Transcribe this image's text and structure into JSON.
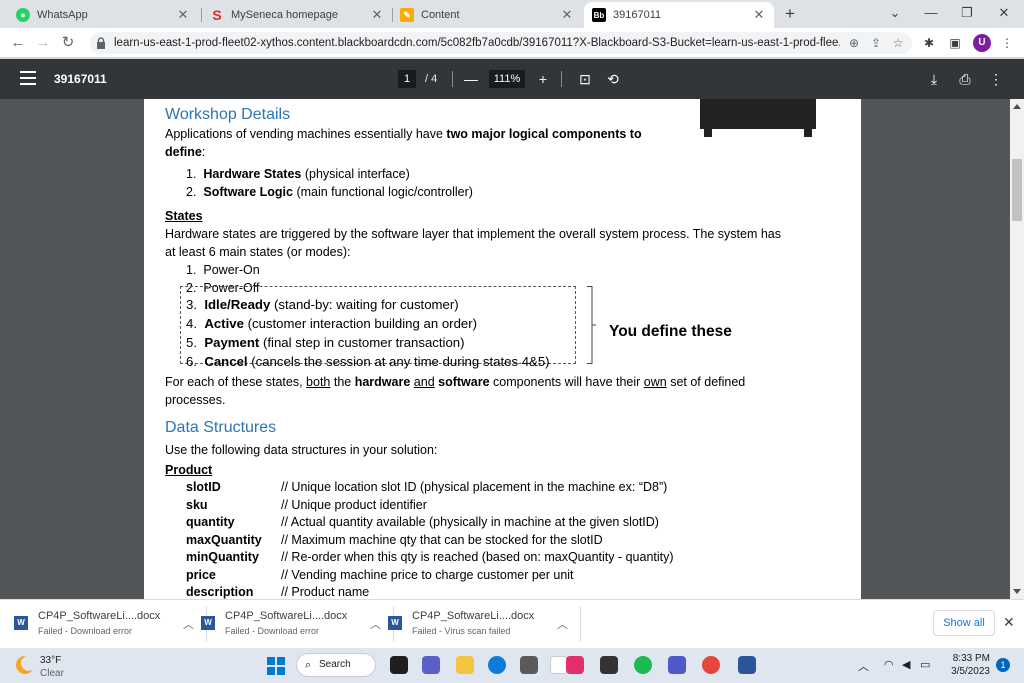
{
  "browser": {
    "tabs": [
      {
        "title": "WhatsApp"
      },
      {
        "title": "MySeneca homepage"
      },
      {
        "title": "Content"
      },
      {
        "title": "39167011"
      }
    ],
    "url": "learn-us-east-1-prod-fleet02-xythos.content.blackboardcdn.com/5c082fb7a0cdb/39167011?X-Blackboard-S3-Bucket=learn-us-east-1-prod-flee...",
    "avatar_letter": "U"
  },
  "pdf_toolbar": {
    "doc_title": "39167011",
    "current_page": "1",
    "total_pages": "/ 4",
    "zoom": "111%",
    "zoom_out": "—",
    "zoom_in": "+"
  },
  "document": {
    "workshop_heading": "Workshop Details",
    "intro_line1_a": "Applications of vending machines essentially have ",
    "intro_line1_b": "two major logical components to",
    "intro_line2_b": "define",
    "intro_line2_c": ":",
    "components": [
      {
        "num": "1.",
        "name": "Hardware States",
        "desc": " (physical interface)"
      },
      {
        "num": "2.",
        "name": "Software Logic",
        "desc": " (main functional logic/controller)"
      }
    ],
    "states_heading": "States",
    "states_line1": "Hardware states are triggered by the software layer that implement the overall system process.  The system has",
    "states_line2": "at least 6 main states (or modes):",
    "states": [
      {
        "num": "1.",
        "name": "",
        "desc": "Power-On"
      },
      {
        "num": "2.",
        "name": "",
        "desc": "Power-Off"
      },
      {
        "num": "3.",
        "name": "Idle/Ready",
        "desc": " (stand-by: waiting for customer)"
      },
      {
        "num": "4.",
        "name": "Active",
        "desc": " (customer interaction building an order)"
      },
      {
        "num": "5.",
        "name": "Payment",
        "desc": " (final step in customer transaction)"
      },
      {
        "num": "6.",
        "name": "Cancel",
        "desc": " (cancels the session at any time during states 4&5)"
      }
    ],
    "you_define": "You define these",
    "each_line1": {
      "a": "For each of these states, ",
      "b": "both",
      "c": " the ",
      "d": "hardware",
      "e": " ",
      "f": "and",
      "g": " ",
      "h": "software",
      "i": " components will have their ",
      "j": "own",
      "k": " set of defined"
    },
    "each_line2": "processes.",
    "ds_heading": "Data Structures",
    "ds_intro": "Use the following data structures in your solution:",
    "product_heading": "Product",
    "product_fields": [
      {
        "name": "slotID",
        "desc": "// Unique location slot ID (physical placement in the machine ex: “D8”)"
      },
      {
        "name": "sku",
        "desc": "// Unique product identifier"
      },
      {
        "name": "quantity",
        "desc": "// Actual quantity available (physically in machine at the given slotID)"
      },
      {
        "name": "maxQuantity",
        "desc": "// Maximum machine qty that can be stocked for the slotID"
      },
      {
        "name": "minQuantity",
        "desc": "// Re-order when this qty is reached (based on: maxQuantity - quantity)"
      },
      {
        "name": "price",
        "desc": "// Vending machine price to charge customer per unit"
      },
      {
        "name": "description",
        "desc": "// Product name"
      }
    ]
  },
  "downloads": {
    "items": [
      {
        "name": "CP4P_SoftwareLi....docx",
        "status": "Failed - Download error"
      },
      {
        "name": "CP4P_SoftwareLi....docx",
        "status": "Failed - Download error"
      },
      {
        "name": "CP4P_SoftwareLi....docx",
        "status": "Failed - Virus scan failed"
      }
    ],
    "show_all": "Show all",
    "file_badge": "W"
  },
  "taskbar": {
    "temperature": "33°F",
    "condition": "Clear",
    "search_label": "Search",
    "time": "8:33 PM",
    "date": "3/5/2023",
    "notification_count": "1"
  }
}
